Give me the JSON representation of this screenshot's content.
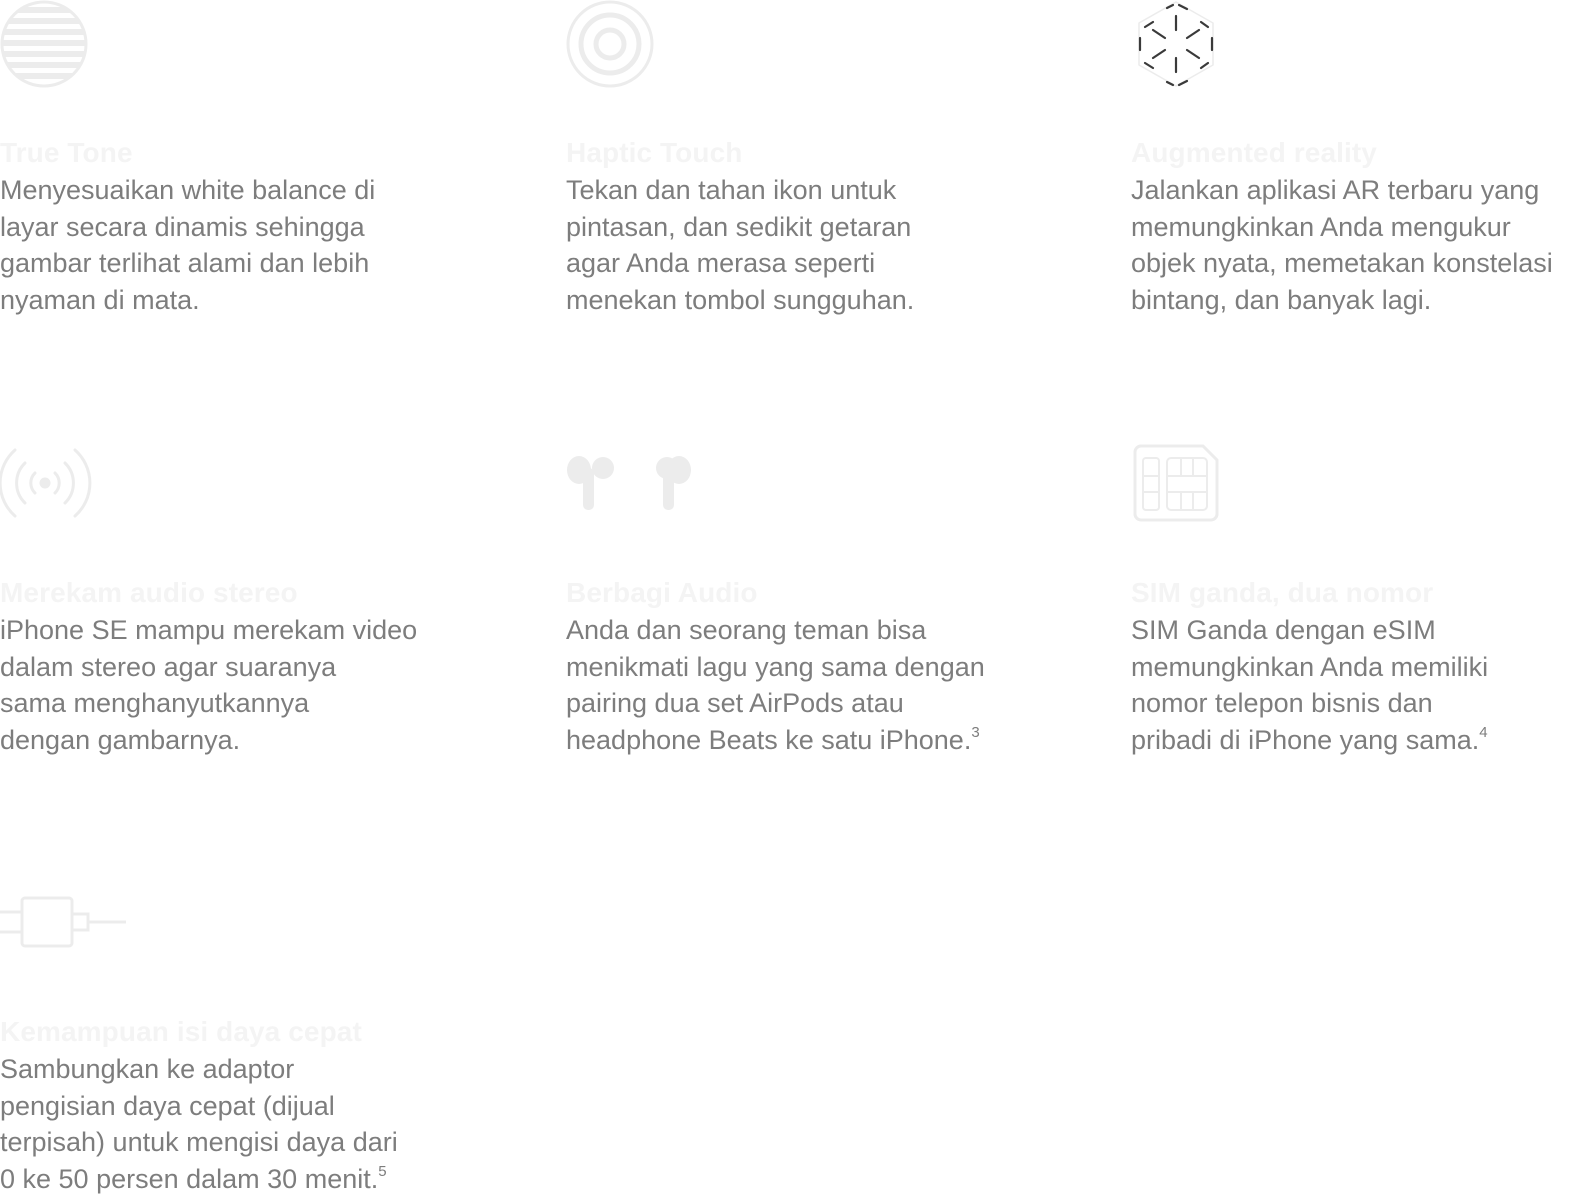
{
  "features": [
    {
      "icon": "true-tone-icon",
      "title": "True Tone",
      "description": "Menyesuaikan white balance di\nlayar secara dinamis sehingga\ngambar terlihat alami dan lebih\nnyaman di mata.",
      "footnote": ""
    },
    {
      "icon": "haptic-touch-icon",
      "title": "Haptic Touch",
      "description": "Tekan dan tahan ikon untuk\npintasan, dan sedikit getaran\nagar Anda merasa seperti\nmenekan tombol sungguhan.",
      "footnote": ""
    },
    {
      "icon": "augmented-reality-icon",
      "title": "Augmented reality",
      "description": "Jalankan aplikasi AR terbaru yang\nmemungkinkan Anda mengukur\nobjek nyata, memetakan konstelasi\nbintang, dan banyak lagi.",
      "footnote": ""
    },
    {
      "icon": "stereo-recording-icon",
      "title": "Merekam audio stereo",
      "description": "iPhone SE mampu merekam video\ndalam stereo agar suaranya\nsama menghanyutkannya\ndengan gambarnya.",
      "footnote": ""
    },
    {
      "icon": "airpods-icon",
      "title": "Berbagi Audio",
      "description": "Anda dan seorang teman bisa\nmenikmati lagu yang sama dengan\npairing dua set AirPods atau\nheadphone Beats ke satu iPhone.",
      "footnote": "3"
    },
    {
      "icon": "dual-sim-icon",
      "title": "SIM ganda, dua nomor",
      "description": "SIM Ganda dengan eSIM\nmemungkinkan Anda memiliki\nnomor telepon bisnis dan\npribadi di iPhone yang sama.",
      "footnote": "4"
    },
    {
      "icon": "fast-charge-adapter-icon",
      "title": "Kemampuan isi daya cepat",
      "description": "Sambungkan ke adaptor\npengisian daya cepat (dijual\nterpisah) untuk mengisi daya dari\n0 ke 50 persen dalam 30 menit.",
      "footnote": "5"
    }
  ],
  "colors": {
    "title": "#f4f4f4",
    "body": "#7d7d7d",
    "icon_faint": "#ececec",
    "icon_dark": "#3a3a3a"
  }
}
